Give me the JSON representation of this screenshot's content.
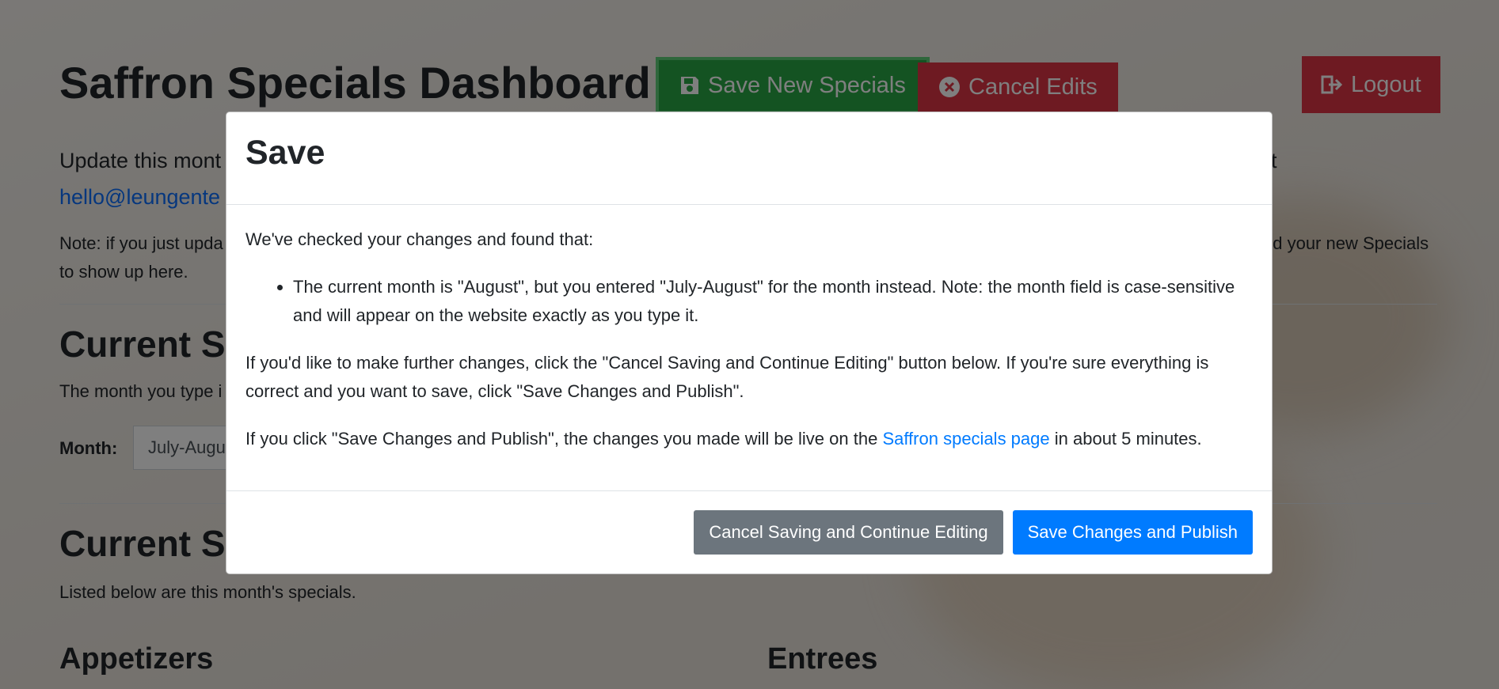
{
  "dashboard": {
    "title": "Saffron Specials Dashboard",
    "save_button": "Save New Specials",
    "cancel_button": "Cancel Edits",
    "logout_button": "Logout",
    "intro_text": "Update this mont",
    "intro_tail": "t",
    "intro_email": "hello@leungente",
    "note_text": "Note: if you just upda",
    "note_tail": "nd your new Specials",
    "note_line2": "to show up here.",
    "current_month_heading": "Current Sp",
    "month_hint": "The month you type i",
    "month_label": "Month:",
    "month_value": "July-Augu",
    "current_specials_heading": "Current Sp",
    "specials_hint": "Listed below are this month's specials.",
    "appetizers_heading": "Appetizers",
    "entrees_heading": "Entrees"
  },
  "modal": {
    "title": "Save",
    "intro": "We've checked your changes and found that:",
    "issues": [
      "The current month is \"August\", but you entered \"July-August\" for the month instead. Note: the month field is case-sensitive and will appear on the website exactly as you type it."
    ],
    "instructions": "If you'd like to make further changes, click the \"Cancel Saving and Continue Editing\" button below. If you're sure everything is correct and you want to save, click \"Save Changes and Publish\".",
    "publish_prefix": "If you click \"Save Changes and Publish\", the changes you made will be live on the",
    "publish_link": "Saffron specials page",
    "publish_suffix": "in about 5 minutes.",
    "cancel_button": "Cancel Saving and Continue Editing",
    "save_button": "Save Changes and Publish"
  },
  "colors": {
    "success": "#28a745",
    "danger": "#dc3545",
    "primary": "#007bff",
    "secondary": "#6c757d",
    "link": "#0d6efd"
  }
}
